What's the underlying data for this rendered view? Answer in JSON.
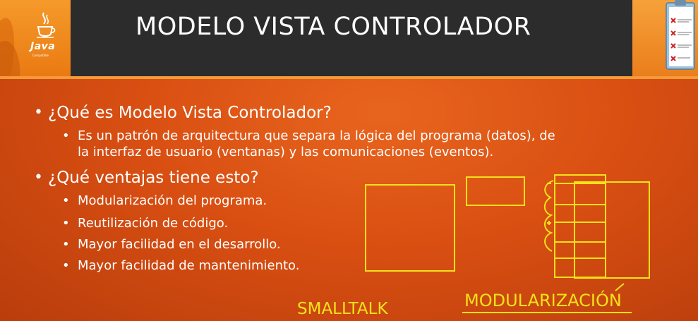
{
  "logo": {
    "brand": "Java",
    "tagline": "Compatible",
    "icon_name": "java-coffee-cup-icon"
  },
  "header": {
    "title": "MODELO VISTA CONTROLADOR"
  },
  "clipboard": {
    "icon_name": "checklist-clipboard-icon"
  },
  "bullets": [
    {
      "text": "¿Qué es Modelo Vista Controlador?",
      "sub": [
        {
          "line1": "Es un patrón de arquitectura que separa la lógica del programa (datos), de",
          "line2": "la interfaz de usuario (ventanas) y las comunicaciones (eventos)."
        }
      ]
    },
    {
      "text": "¿Qué ventajas tiene esto?",
      "sub": [
        {
          "text": "Modularización del programa."
        },
        {
          "text": "Reutilización de código."
        },
        {
          "text": "Mayor facilidad en el desarrollo."
        },
        {
          "text": "Mayor facilidad de mantenimiento."
        }
      ]
    }
  ],
  "annotations": {
    "smalltalk": "SMALLTALK",
    "modularizacion": "MODULARIZACIÓN"
  },
  "colors": {
    "title_bar": "#2c2c2c",
    "accent_orange": "#f39a3a",
    "annotation_yellow": "#f3e21a",
    "background": "#d94f12"
  }
}
